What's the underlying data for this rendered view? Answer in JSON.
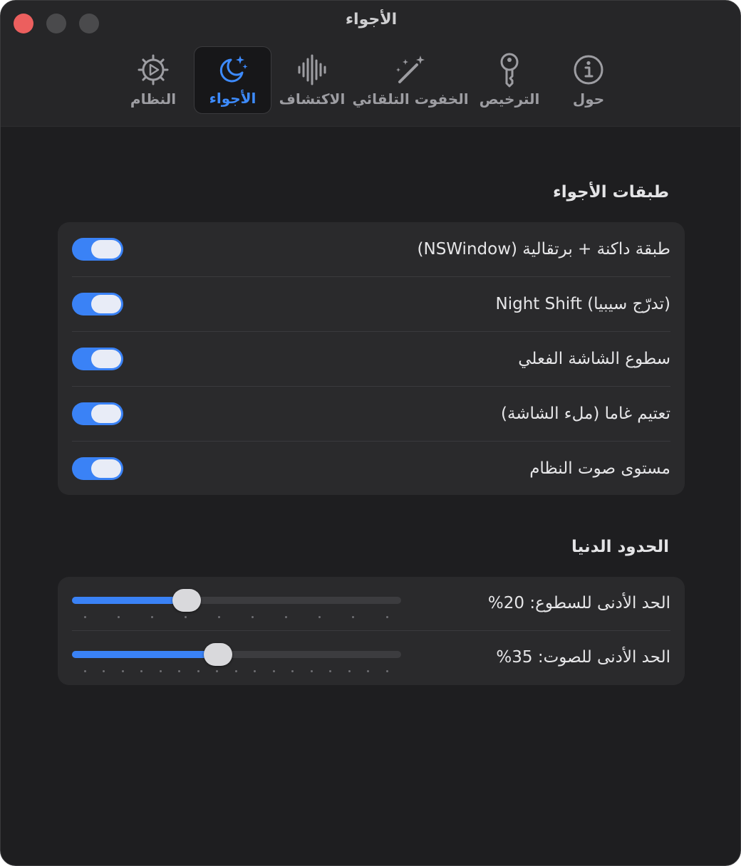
{
  "window": {
    "title": "الأجواء"
  },
  "tabs": [
    {
      "name": "system",
      "label": "النظام",
      "icon": "gear-play-icon",
      "selected": false
    },
    {
      "name": "ambience",
      "label": "الأجواء",
      "icon": "moon-stars-icon",
      "selected": true
    },
    {
      "name": "detection",
      "label": "الاكتشاف",
      "icon": "waveform-icon",
      "selected": false
    },
    {
      "name": "auto-dim",
      "label": "الخفوت التلقائي",
      "icon": "magic-wand-icon",
      "selected": false
    },
    {
      "name": "license",
      "label": "الترخيص",
      "icon": "key-icon",
      "selected": false
    },
    {
      "name": "about",
      "label": "حول",
      "icon": "info-circle-icon",
      "selected": false
    }
  ],
  "layers": {
    "title": "طبقات الأجواء",
    "items": [
      {
        "label": "طبقة داكنة + برتقالية (NSWindow)",
        "on": true
      },
      {
        "label": "Night Shift (تدرّج سيبيا)",
        "on": true
      },
      {
        "label": "سطوع الشاشة الفعلي",
        "on": true
      },
      {
        "label": "تعتيم غاما (ملء الشاشة)",
        "on": true
      },
      {
        "label": "مستوى صوت النظام",
        "on": true
      }
    ]
  },
  "minimums": {
    "title": "الحدود الدنيا",
    "sliders": [
      {
        "label": "الحد الأدنى للسطوع: 20%",
        "value": 20,
        "min": 0,
        "max": 60,
        "ticks": 10
      },
      {
        "label": "الحد الأدنى للصوت: 35%",
        "value": 35,
        "min": 0,
        "max": 80,
        "ticks": 17
      }
    ]
  },
  "colors": {
    "accent": "#3a82f6",
    "close": "#ec5f5e",
    "background": "#1e1e20",
    "card": "#2a2a2c"
  }
}
